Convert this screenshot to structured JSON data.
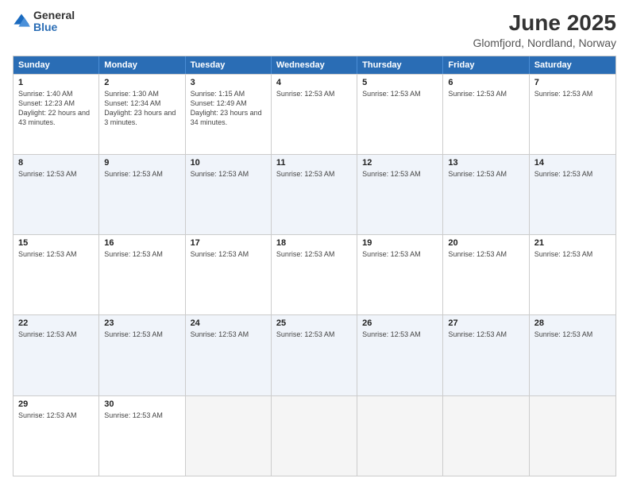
{
  "logo": {
    "line1": "General",
    "line2": "Blue"
  },
  "title": "June 2025",
  "subtitle": "Glomfjord, Nordland, Norway",
  "weekdays": [
    "Sunday",
    "Monday",
    "Tuesday",
    "Wednesday",
    "Thursday",
    "Friday",
    "Saturday"
  ],
  "weeks": [
    [
      {
        "day": "1",
        "info": "Sunrise: 1:40 AM\nSunset: 12:23 AM\nDaylight: 22 hours and 43 minutes.",
        "shade": false,
        "empty": false
      },
      {
        "day": "2",
        "info": "Sunrise: 1:30 AM\nSunset: 12:34 AM\nDaylight: 23 hours and 3 minutes.",
        "shade": false,
        "empty": false
      },
      {
        "day": "3",
        "info": "Sunrise: 1:15 AM\nSunset: 12:49 AM\nDaylight: 23 hours and 34 minutes.",
        "shade": false,
        "empty": false
      },
      {
        "day": "4",
        "info": "Sunrise: 12:53 AM",
        "shade": false,
        "empty": false
      },
      {
        "day": "5",
        "info": "Sunrise: 12:53 AM",
        "shade": false,
        "empty": false
      },
      {
        "day": "6",
        "info": "Sunrise: 12:53 AM",
        "shade": false,
        "empty": false
      },
      {
        "day": "7",
        "info": "Sunrise: 12:53 AM",
        "shade": false,
        "empty": false
      }
    ],
    [
      {
        "day": "8",
        "info": "Sunrise: 12:53 AM",
        "shade": true,
        "empty": false
      },
      {
        "day": "9",
        "info": "Sunrise: 12:53 AM",
        "shade": true,
        "empty": false
      },
      {
        "day": "10",
        "info": "Sunrise: 12:53 AM",
        "shade": true,
        "empty": false
      },
      {
        "day": "11",
        "info": "Sunrise: 12:53 AM",
        "shade": true,
        "empty": false
      },
      {
        "day": "12",
        "info": "Sunrise: 12:53 AM",
        "shade": true,
        "empty": false
      },
      {
        "day": "13",
        "info": "Sunrise: 12:53 AM",
        "shade": true,
        "empty": false
      },
      {
        "day": "14",
        "info": "Sunrise: 12:53 AM",
        "shade": true,
        "empty": false
      }
    ],
    [
      {
        "day": "15",
        "info": "Sunrise: 12:53 AM",
        "shade": false,
        "empty": false
      },
      {
        "day": "16",
        "info": "Sunrise: 12:53 AM",
        "shade": false,
        "empty": false
      },
      {
        "day": "17",
        "info": "Sunrise: 12:53 AM",
        "shade": false,
        "empty": false
      },
      {
        "day": "18",
        "info": "Sunrise: 12:53 AM",
        "shade": false,
        "empty": false
      },
      {
        "day": "19",
        "info": "Sunrise: 12:53 AM",
        "shade": false,
        "empty": false
      },
      {
        "day": "20",
        "info": "Sunrise: 12:53 AM",
        "shade": false,
        "empty": false
      },
      {
        "day": "21",
        "info": "Sunrise: 12:53 AM",
        "shade": false,
        "empty": false
      }
    ],
    [
      {
        "day": "22",
        "info": "Sunrise: 12:53 AM",
        "shade": true,
        "empty": false
      },
      {
        "day": "23",
        "info": "Sunrise: 12:53 AM",
        "shade": true,
        "empty": false
      },
      {
        "day": "24",
        "info": "Sunrise: 12:53 AM",
        "shade": true,
        "empty": false
      },
      {
        "day": "25",
        "info": "Sunrise: 12:53 AM",
        "shade": true,
        "empty": false
      },
      {
        "day": "26",
        "info": "Sunrise: 12:53 AM",
        "shade": true,
        "empty": false
      },
      {
        "day": "27",
        "info": "Sunrise: 12:53 AM",
        "shade": true,
        "empty": false
      },
      {
        "day": "28",
        "info": "Sunrise: 12:53 AM",
        "shade": true,
        "empty": false
      }
    ],
    [
      {
        "day": "29",
        "info": "Sunrise: 12:53 AM",
        "shade": false,
        "empty": false
      },
      {
        "day": "30",
        "info": "Sunrise: 12:53 AM",
        "shade": false,
        "empty": false
      },
      {
        "day": "",
        "info": "",
        "shade": false,
        "empty": true
      },
      {
        "day": "",
        "info": "",
        "shade": false,
        "empty": true
      },
      {
        "day": "",
        "info": "",
        "shade": false,
        "empty": true
      },
      {
        "day": "",
        "info": "",
        "shade": false,
        "empty": true
      },
      {
        "day": "",
        "info": "",
        "shade": false,
        "empty": true
      }
    ]
  ]
}
